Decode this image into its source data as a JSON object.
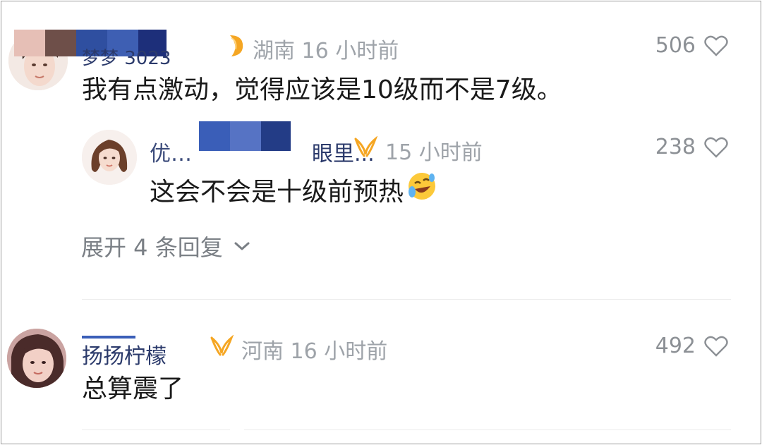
{
  "comments": [
    {
      "location_time": "湖南 16 小时前",
      "likes": "506",
      "text": "我有点激动，觉得应该是10级而不是7级。",
      "badge_icon": "medal-icon",
      "avatar_icon": "user-avatar"
    },
    {
      "name_partial": "眼里...",
      "time": "15 小时前",
      "likes": "238",
      "text": "这会不会是十级前预热",
      "emoji": "laughing-crying-emoji",
      "badge_icon": "ribbon-icon"
    },
    {
      "location_time": "河南 16 小时前",
      "likes": "492",
      "text": "总算震了",
      "badge_icon": "ribbon-icon"
    }
  ],
  "expand_replies": "展开 4 条回复",
  "colors": {
    "meta": "#9ea3a9",
    "badge_orange": "#f5a623",
    "redact_blue": "#1f3a8a",
    "name_blue": "#2b3a6b"
  }
}
